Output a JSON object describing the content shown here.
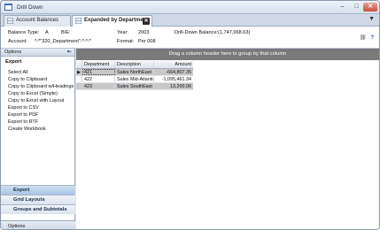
{
  "window": {
    "title": "Drill Down"
  },
  "tabs": [
    {
      "label": "Account Balances"
    },
    {
      "label": "Expanded by Department"
    }
  ],
  "info": {
    "balance_type_label": "Balance Type:",
    "balance_type_value": "A",
    "be_label": "B/E:",
    "year_label": "Year:",
    "year_value": "2003",
    "drill_label": "Drill-Down Balance:",
    "drill_value": "(1,747,068.63)",
    "account_label": "Account:",
    "account_value": "*-*\"320_Department\"-*-*-*",
    "format_label": "Format:",
    "format_value": "Per 008"
  },
  "options_panel": {
    "header": "Options",
    "section_title": "Export",
    "items": [
      "Select All",
      "Copy to Clipboard",
      "Copy to Clipboard w/Headings",
      "Copy to Excel (Simple)",
      "Copy to Excel with Layout",
      "Export to CSV",
      "Export to PDF",
      "Export to RTF",
      "Create Workbook"
    ],
    "nav": [
      "Export",
      "Grid Layouts",
      "Groups and Subtotals"
    ],
    "bottom": "Options"
  },
  "grid": {
    "group_hint": "Drag a column header here to group by that column",
    "columns": [
      "Department",
      "Description",
      "Amount"
    ],
    "rows": [
      {
        "indicator": "▶",
        "department": "421",
        "description": "Sales NorthEast",
        "amount": "-664,807.35"
      },
      {
        "indicator": "",
        "department": "422",
        "description": "Sales Mid-Atlantic",
        "amount": "-1,095,461.34"
      },
      {
        "indicator": "",
        "department": "423",
        "description": "Sales SouthEast",
        "amount": "13,200.06"
      }
    ]
  },
  "colors": {
    "accent": "#a9c3e5",
    "group_bar": "#7a7a7a",
    "close": "#c94b3b"
  }
}
